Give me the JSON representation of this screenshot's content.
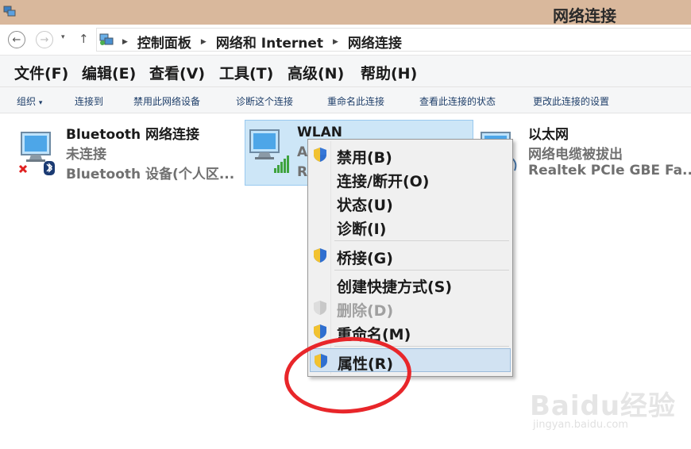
{
  "window": {
    "title": "网络连接"
  },
  "address": {
    "breadcrumbs": [
      "控制面板",
      "网络和 Internet",
      "网络连接"
    ]
  },
  "menu": [
    "文件(F)",
    "编辑(E)",
    "查看(V)",
    "工具(T)",
    "高级(N)",
    "帮助(H)"
  ],
  "commands": [
    {
      "label": "组织",
      "has_dropdown": true,
      "dropdown_glyph": "▾"
    },
    {
      "label": "连接到"
    },
    {
      "label": "禁用此网络设备"
    },
    {
      "label": "诊断这个连接"
    },
    {
      "label": "重命名此连接"
    },
    {
      "label": "查看此连接的状态"
    },
    {
      "label": "更改此连接的设置"
    }
  ],
  "connections": [
    {
      "name": "Bluetooth 网络连接",
      "status": "未连接",
      "device": "Bluetooth 设备(个人区...",
      "selected": false
    },
    {
      "name": "WLAN",
      "status": "A",
      "device": "R",
      "selected": true
    },
    {
      "name": "以太网",
      "status": "网络电缆被拔出",
      "device": "Realtek PCIe GBE Fa...",
      "selected": false
    }
  ],
  "context_menu": {
    "items": [
      {
        "label": "禁用(B)",
        "shield": true,
        "disabled": false
      },
      {
        "label": "连接/断开(O)",
        "shield": false,
        "disabled": false
      },
      {
        "label": "状态(U)",
        "shield": false,
        "disabled": false
      },
      {
        "label": "诊断(I)",
        "shield": false,
        "disabled": false
      },
      {
        "label": "桥接(G)",
        "shield": true,
        "disabled": false
      },
      {
        "label": "创建快捷方式(S)",
        "shield": false,
        "disabled": false
      },
      {
        "label": "删除(D)",
        "shield": true,
        "disabled": true
      },
      {
        "label": "重命名(M)",
        "shield": true,
        "disabled": false
      },
      {
        "label": "属性(R)",
        "shield": true,
        "disabled": false,
        "highlighted": true
      }
    ]
  },
  "annotation": {
    "color": "#e8262a"
  },
  "watermark": {
    "brand": "Baidu经验",
    "url": "jingyan.baidu.com"
  },
  "colors": {
    "titlebar": "#d9b89c",
    "selection": "#cde6f7",
    "command_text": "#1f3f6a"
  }
}
